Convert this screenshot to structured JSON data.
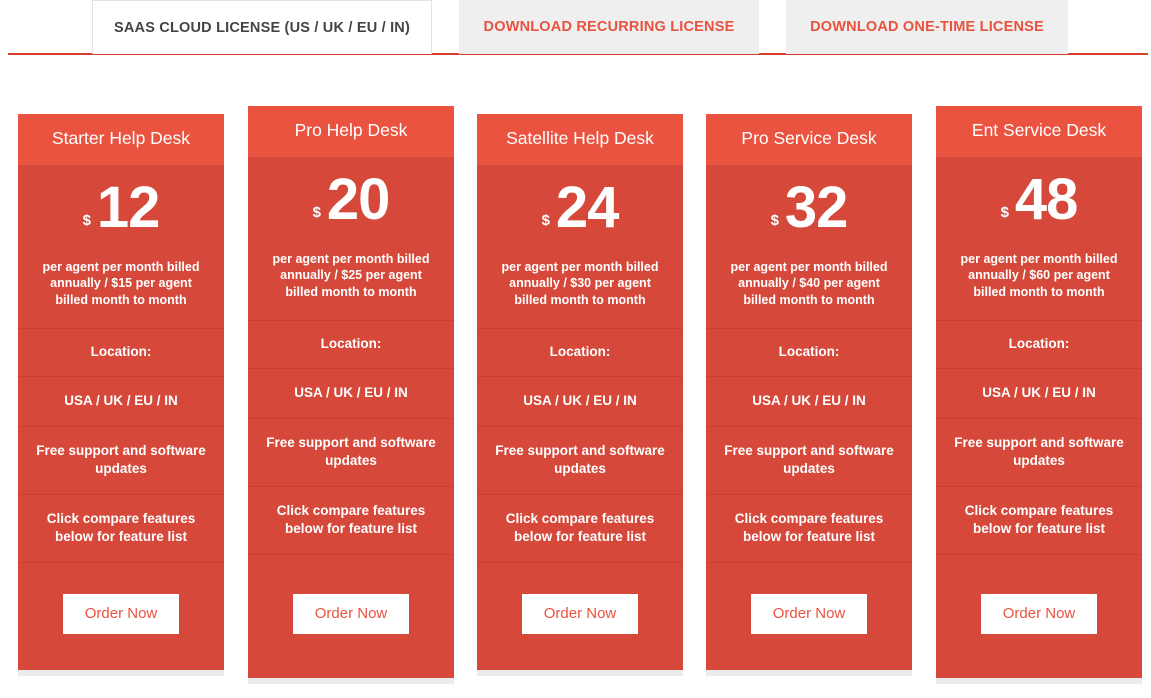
{
  "tabs": [
    {
      "label": "SAAS CLOUD LICENSE (US / UK / EU / IN)",
      "state": "active"
    },
    {
      "label": "DOWNLOAD RECURRING LICENSE",
      "state": "inactive"
    },
    {
      "label": "DOWNLOAD ONE-TIME LICENSE",
      "state": "inactive"
    }
  ],
  "colors": {
    "accent": "#e9523f",
    "card_header": "#ea5340",
    "card_body": "#d5483a",
    "divider": "#c9402f",
    "tab_inactive_bg": "#efefef",
    "underline": "#d8402e"
  },
  "plans": [
    {
      "name": "Starter Help Desk",
      "currency": "$",
      "price": "12",
      "price_note": "per agent per month billed annually / $15 per agent billed month to month",
      "features": [
        "Location:",
        "USA / UK / EU / IN",
        "Free support and software updates",
        "Click compare features below for feature list"
      ],
      "cta": "Order Now"
    },
    {
      "name": "Pro Help Desk",
      "currency": "$",
      "price": "20",
      "price_note": "per agent per month billed annually / $25 per agent billed month to month",
      "features": [
        "Location:",
        "USA / UK / EU / IN",
        "Free support and software updates",
        "Click compare features below for feature list"
      ],
      "cta": "Order Now"
    },
    {
      "name": "Satellite Help Desk",
      "currency": "$",
      "price": "24",
      "price_note": "per agent per month billed annually / $30 per agent billed month to month",
      "features": [
        "Location:",
        "USA / UK / EU / IN",
        "Free support and software updates",
        "Click compare features below for feature list"
      ],
      "cta": "Order Now"
    },
    {
      "name": "Pro Service Desk",
      "currency": "$",
      "price": "32",
      "price_note": "per agent per month billed annually / $40 per agent billed month to month",
      "features": [
        "Location:",
        "USA / UK / EU / IN",
        "Free support and software updates",
        "Click compare features below for feature list"
      ],
      "cta": "Order Now"
    },
    {
      "name": "Ent Service Desk",
      "currency": "$",
      "price": "48",
      "price_note": "per agent per month billed annually / $60 per agent billed month to month",
      "features": [
        "Location:",
        "USA / UK / EU / IN",
        "Free support and software updates",
        "Click compare features below for feature list"
      ],
      "cta": "Order Now"
    }
  ]
}
